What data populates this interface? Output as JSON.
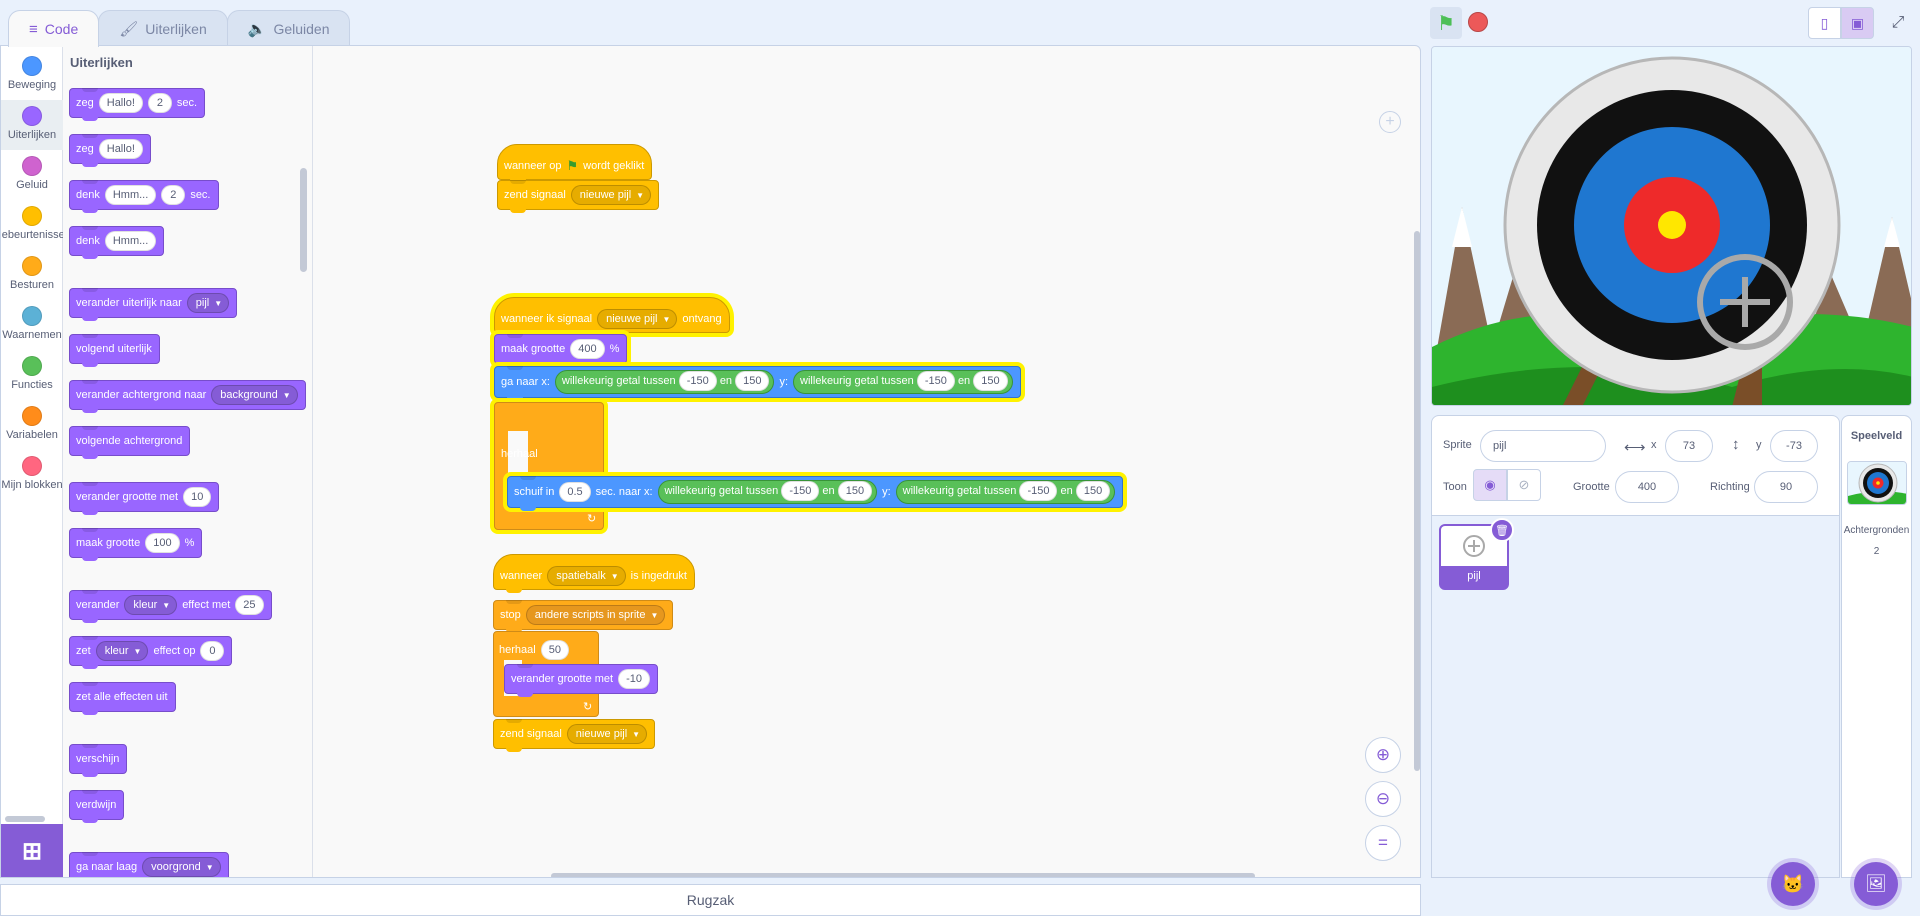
{
  "tabs": [
    {
      "label": "Code",
      "icon": "code-icon"
    },
    {
      "label": "Uiterlijken",
      "icon": "brush-icon"
    },
    {
      "label": "Geluiden",
      "icon": "speaker-icon"
    }
  ],
  "categories": [
    {
      "label": "Beweging",
      "color": "#4c97ff"
    },
    {
      "label": "Uiterlijken",
      "color": "#9966ff"
    },
    {
      "label": "Geluid",
      "color": "#cf63cf"
    },
    {
      "label": "Gebeurtenissen",
      "color": "#ffbf00"
    },
    {
      "label": "Besturen",
      "color": "#ffab19"
    },
    {
      "label": "Waarnemen",
      "color": "#5cb1d6"
    },
    {
      "label": "Functies",
      "color": "#59c059"
    },
    {
      "label": "Variabelen",
      "color": "#ff8c1a"
    },
    {
      "label": "Mijn blokken",
      "color": "#ff6680"
    }
  ],
  "flyout": {
    "title": "Uiterlijken",
    "say_secs": {
      "t1": "zeg",
      "v1": "Hallo!",
      "v2": "2",
      "t2": "sec."
    },
    "say": {
      "t1": "zeg",
      "v1": "Hallo!"
    },
    "think_secs": {
      "t1": "denk",
      "v1": "Hmm...",
      "v2": "2",
      "t2": "sec."
    },
    "think": {
      "t1": "denk",
      "v1": "Hmm..."
    },
    "switch_costume": {
      "t1": "verander uiterlijk naar",
      "v1": "pijl"
    },
    "next_costume": {
      "t1": "volgend uiterlijk"
    },
    "switch_backdrop": {
      "t1": "verander achtergrond naar",
      "v1": "background"
    },
    "next_backdrop": {
      "t1": "volgende achtergrond"
    },
    "change_size": {
      "t1": "verander grootte met",
      "v1": "10"
    },
    "set_size": {
      "t1": "maak grootte",
      "v1": "100",
      "t2": "%"
    },
    "change_effect": {
      "t1": "verander",
      "v1": "kleur",
      "t2": "effect met",
      "v2": "25"
    },
    "set_effect": {
      "t1": "zet",
      "v1": "kleur",
      "t2": "effect op",
      "v2": "0"
    },
    "clear_effects": {
      "t1": "zet alle effecten uit"
    },
    "show": {
      "t1": "verschijn"
    },
    "hide": {
      "t1": "verdwijn"
    },
    "go_layer": {
      "t1": "ga naar laag",
      "v1": "voorgrond"
    }
  },
  "scripts": {
    "s1": {
      "hat": {
        "t1": "wanneer op",
        "t2": "wordt geklikt"
      },
      "broadcast": {
        "t1": "zend signaal",
        "v1": "nieuwe pijl"
      }
    },
    "s2": {
      "hat": {
        "t1": "wanneer ik signaal",
        "v1": "nieuwe pijl",
        "t2": "ontvang"
      },
      "set_size": {
        "t1": "maak grootte",
        "v1": "400",
        "t2": "%"
      },
      "goto": {
        "t1": "ga naar x:",
        "r": "willekeurig getal tussen",
        "a1": "-150",
        "en": "en",
        "b1": "150",
        "y": "y:",
        "a2": "-150",
        "b2": "150"
      },
      "repeat": {
        "t1": "herhaal"
      },
      "glide": {
        "t1": "schuif in",
        "v1": "0.5",
        "t2": "sec. naar x:",
        "r": "willekeurig getal tussen",
        "a1": "-150",
        "en": "en",
        "b1": "150",
        "y": "y:",
        "a2": "-150",
        "b2": "150"
      }
    },
    "s3": {
      "hat": {
        "t1": "wanneer",
        "v1": "spatiebalk",
        "t2": "is ingedrukt"
      },
      "stop": {
        "t1": "stop",
        "v1": "andere scripts in sprite"
      },
      "repeat": {
        "t1": "herhaal",
        "v1": "50"
      },
      "change_size": {
        "t1": "verander grootte met",
        "v1": "-10"
      },
      "broadcast": {
        "t1": "zend signaal",
        "v1": "nieuwe pijl"
      }
    }
  },
  "backpack": "Rugzak",
  "sprite_info": {
    "sprite_label": "Sprite",
    "sprite_name": "pijl",
    "x_label": "x",
    "x": "73",
    "y_label": "y",
    "y": "-73",
    "show_label": "Toon",
    "size_label": "Grootte",
    "size": "400",
    "direction_label": "Richting",
    "direction": "90"
  },
  "sprites": [
    {
      "name": "pijl"
    }
  ],
  "stage_panel": {
    "title": "Speelveld",
    "backdrops_label": "Achtergronden",
    "backdrops_count": "2"
  }
}
